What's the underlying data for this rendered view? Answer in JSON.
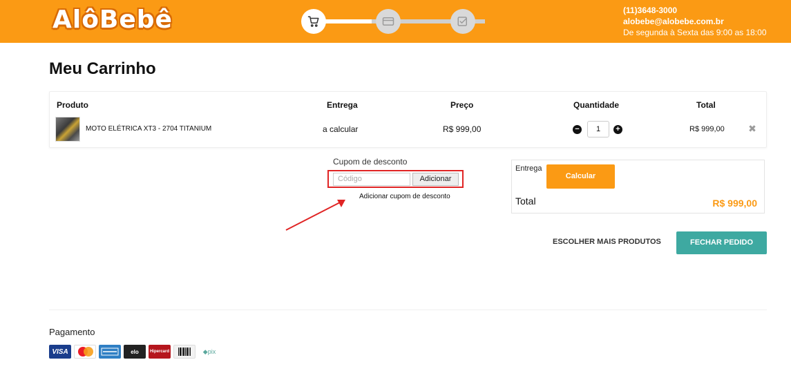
{
  "header": {
    "logo": "AlôBebê",
    "contact_phone": "(11)3648-3000",
    "contact_email": "alobebe@alobebe.com.br",
    "contact_hours": "De segunda à Sexta das 9:00 as 18:00",
    "steps": [
      {
        "icon": "cart-icon",
        "active": true
      },
      {
        "icon": "credit-card-icon",
        "active": false
      },
      {
        "icon": "checklist-icon",
        "active": false
      }
    ]
  },
  "page_title": "Meu Carrinho",
  "cart": {
    "columns": [
      "Produto",
      "Entrega",
      "Preço",
      "Quantidade",
      "Total"
    ],
    "items": [
      {
        "product": "MOTO ELÉTRICA XT3 - 2704 TITANIUM",
        "delivery": "a calcular",
        "price": "R$ 999,00",
        "quantity": "1",
        "total": "R$ 999,00",
        "remove_icon": "close-icon"
      }
    ]
  },
  "coupon": {
    "label": "Cupom de desconto",
    "placeholder": "Código",
    "button": "Adicionar",
    "hint": "Adicionar cupom de desconto",
    "highlight_color": "#e02424"
  },
  "summary": {
    "delivery_label": "Entrega",
    "calc_button": "Calcular",
    "total_label": "Total",
    "total_value": "R$ 999,00"
  },
  "actions": {
    "more_products": "ESCOLHER MAIS PRODUTOS",
    "close_order": "FECHAR PEDIDO"
  },
  "payment": {
    "title": "Pagamento",
    "methods": [
      {
        "icon": "visa-icon",
        "text": "VISA"
      },
      {
        "icon": "mastercard-icon",
        "text": ""
      },
      {
        "icon": "amex-icon",
        "text": ""
      },
      {
        "icon": "elo-icon",
        "text": "elo"
      },
      {
        "icon": "hipercard-icon",
        "text": "Hipercard"
      },
      {
        "icon": "boleto-icon",
        "text": ""
      },
      {
        "icon": "pix-icon",
        "text": "pix"
      }
    ]
  },
  "colors": {
    "brand_orange": "#fb9a14",
    "teal_button": "#3ea9a1"
  }
}
